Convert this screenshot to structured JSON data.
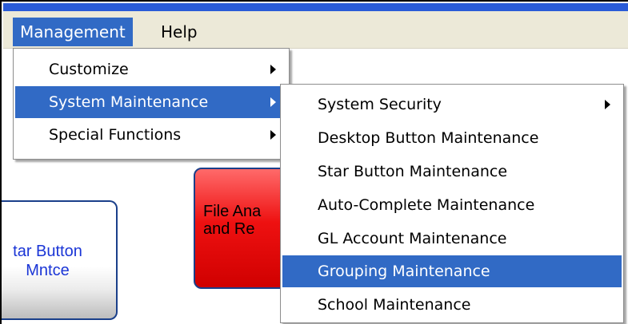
{
  "menubar": {
    "items": [
      {
        "label": "Management",
        "active": true
      },
      {
        "label": "Help",
        "active": false
      }
    ]
  },
  "desktop": {
    "star_button": {
      "label_line1": "tar Button",
      "label_line2": "Mntce"
    },
    "file_button": {
      "label_line1": "File Ana",
      "label_line2": "and Re"
    }
  },
  "management_menu": {
    "items": [
      {
        "label": "Customize",
        "submenu": true,
        "highlighted": false
      },
      {
        "label": "System Maintenance",
        "submenu": true,
        "highlighted": true
      },
      {
        "label": "Special Functions",
        "submenu": true,
        "highlighted": false
      }
    ]
  },
  "system_maintenance_menu": {
    "items": [
      {
        "label": "System Security",
        "submenu": true,
        "highlighted": false
      },
      {
        "label": "Desktop Button Maintenance",
        "submenu": false,
        "highlighted": false
      },
      {
        "label": "Star Button Maintenance",
        "submenu": false,
        "highlighted": false
      },
      {
        "label": "Auto-Complete Maintenance",
        "submenu": false,
        "highlighted": false
      },
      {
        "label": "GL Account Maintenance",
        "submenu": false,
        "highlighted": false
      },
      {
        "label": "Grouping Maintenance",
        "submenu": false,
        "highlighted": true
      },
      {
        "label": "School Maintenance",
        "submenu": false,
        "highlighted": false
      }
    ]
  },
  "colors": {
    "highlight": "#316ac5",
    "menubar_bg": "#ece9d8",
    "title_strip": "#2a5bd7"
  }
}
